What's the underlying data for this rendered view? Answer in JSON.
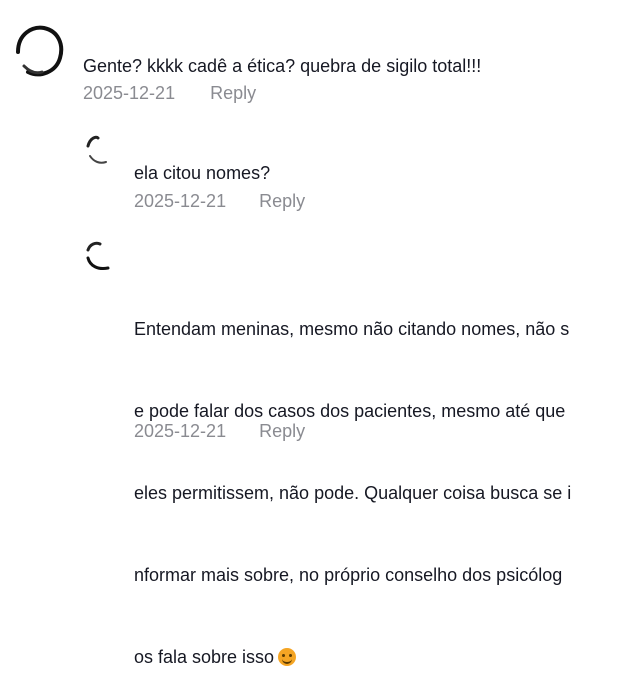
{
  "comments": [
    {
      "text": "Gente? kkkk cadê a ética? quebra de sigilo total!!!",
      "date": "2025-12-21",
      "reply_label": "Reply"
    },
    {
      "text": "ela citou nomes?",
      "date": "2025-12-21",
      "reply_label": "Reply"
    },
    {
      "lines": [
        "Entendam meninas, mesmo não citando nomes, não s",
        "e pode falar dos casos dos pacientes, mesmo até que",
        "eles permitissem, não pode. Qualquer coisa busca se i",
        "nformar mais sobre, no próprio conselho dos psicólog",
        "os fala sobre isso"
      ],
      "emoji": "smiling-face-emoji",
      "date": "2025-12-21",
      "reply_label": "Reply"
    }
  ]
}
